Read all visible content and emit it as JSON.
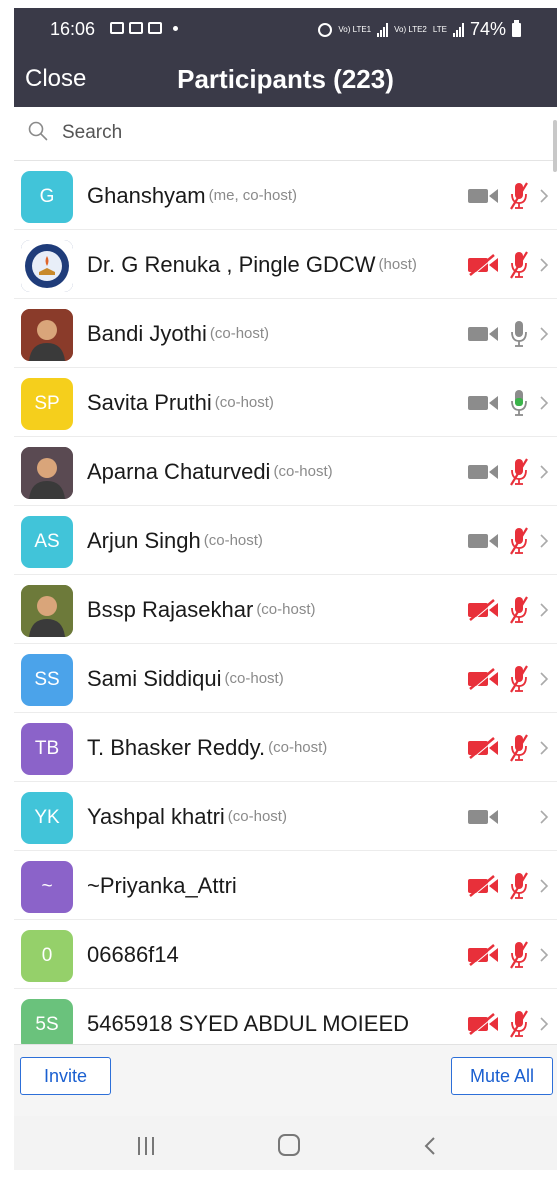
{
  "status_bar": {
    "time": "16:06",
    "net1": "Vo) LTE1",
    "net2": "Vo) LTE2",
    "lte": "LTE",
    "battery": "74%"
  },
  "header": {
    "close_label": "Close",
    "title": "Participants (223)"
  },
  "search": {
    "placeholder": "Search"
  },
  "colors": {
    "header_bg": "#3a3a48",
    "muted_red": "#e8303a",
    "mic_active_green": "#3bb34a",
    "icon_gray": "#8c8c8c",
    "button_blue": "#1a5fd0"
  },
  "participants": [
    {
      "initials": "G",
      "avatar_type": "initials",
      "avatar_color": "#41c4d9",
      "name": "Ghanshyam",
      "role": "(me, co-host)",
      "video": "on",
      "audio": "muted"
    },
    {
      "initials": "",
      "avatar_type": "logo",
      "avatar_color": "#1f3c7a",
      "name": "Dr. G Renuka , Pingle GDCW",
      "role": "(host)",
      "video": "off",
      "audio": "muted"
    },
    {
      "initials": "",
      "avatar_type": "photo",
      "avatar_color": "#8a3b2a",
      "name": "Bandi Jyothi",
      "role": "(co-host)",
      "video": "on",
      "audio": "on"
    },
    {
      "initials": "SP",
      "avatar_type": "initials",
      "avatar_color": "#f5cf1c",
      "name": "Savita Pruthi",
      "role": "(co-host)",
      "video": "on",
      "audio": "speaking"
    },
    {
      "initials": "",
      "avatar_type": "photo",
      "avatar_color": "#5a4a52",
      "name": "Aparna Chaturvedi",
      "role": "(co-host)",
      "video": "on",
      "audio": "muted"
    },
    {
      "initials": "AS",
      "avatar_type": "initials",
      "avatar_color": "#41c4d9",
      "name": "Arjun Singh",
      "role": "(co-host)",
      "video": "on",
      "audio": "muted"
    },
    {
      "initials": "",
      "avatar_type": "photo",
      "avatar_color": "#6d7a3a",
      "name": "Bssp Rajasekhar",
      "role": "(co-host)",
      "video": "off",
      "audio": "muted"
    },
    {
      "initials": "SS",
      "avatar_type": "initials",
      "avatar_color": "#4ba3ea",
      "name": "Sami Siddiqui",
      "role": "(co-host)",
      "video": "off",
      "audio": "muted"
    },
    {
      "initials": "TB",
      "avatar_type": "initials",
      "avatar_color": "#8b63c9",
      "name": "T. Bhasker Reddy.",
      "role": "(co-host)",
      "video": "off",
      "audio": "muted"
    },
    {
      "initials": "YK",
      "avatar_type": "initials",
      "avatar_color": "#41c4d9",
      "name": "Yashpal khatri",
      "role": "(co-host)",
      "video": "on",
      "audio": "none"
    },
    {
      "initials": "~",
      "avatar_type": "initials",
      "avatar_color": "#8b63c9",
      "name": "~Priyanka_Attri",
      "role": "",
      "video": "off",
      "audio": "muted"
    },
    {
      "initials": "0",
      "avatar_type": "initials",
      "avatar_color": "#95d06a",
      "name": "06686f14",
      "role": "",
      "video": "off",
      "audio": "muted"
    },
    {
      "initials": "5S",
      "avatar_type": "initials",
      "avatar_color": "#6ac27c",
      "name": "5465918 SYED ABDUL MOIEED",
      "role": "",
      "video": "off",
      "audio": "muted"
    }
  ],
  "footer": {
    "invite_label": "Invite",
    "mute_all_label": "Mute All"
  }
}
